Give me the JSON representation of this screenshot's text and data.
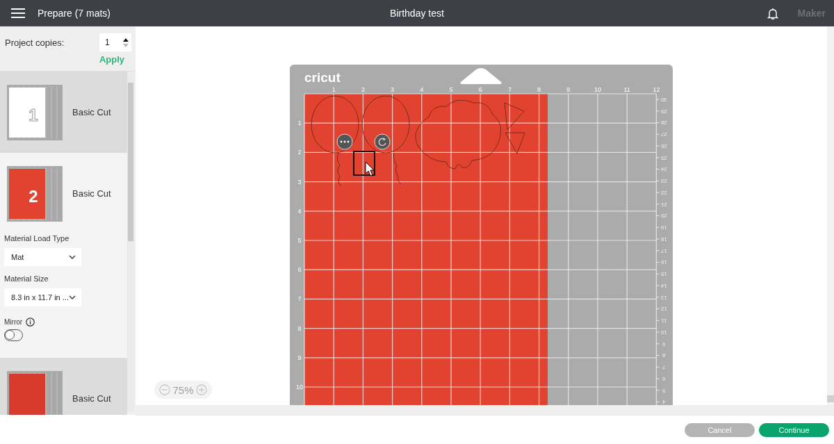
{
  "header": {
    "title": "Prepare (7 mats)",
    "project": "Birthday test",
    "machine": {
      "label": "Maker",
      "disabled": true
    }
  },
  "sidebar": {
    "copies_label": "Project copies:",
    "copies_value": "1",
    "apply": "Apply",
    "mats": [
      {
        "number": "1",
        "label": "Basic Cut",
        "color": "#ffffff",
        "selected": false
      },
      {
        "number": "2",
        "label": "Basic Cut",
        "color": "#e24330",
        "selected": true,
        "options": {
          "load_type_label": "Material Load Type",
          "load_type": "Mat",
          "size_label": "Material Size",
          "size": "8.3 in x 11.7 in ...",
          "mirror_label": "Mirror",
          "mirror_on": false
        }
      },
      {
        "label": "Basic Cut",
        "color": "#d63b2b",
        "selected": false
      }
    ]
  },
  "mat": {
    "logo": "cricut",
    "top_ruler": [
      "1",
      "2",
      "3",
      "4",
      "5",
      "6",
      "7",
      "8",
      "9",
      "10",
      "11",
      "12"
    ],
    "left_ruler": [
      "1",
      "2",
      "3",
      "4",
      "5",
      "6",
      "7",
      "8",
      "9",
      "10"
    ],
    "right_ruler": [
      "30",
      "29",
      "28",
      "27",
      "26",
      "25",
      "24",
      "23",
      "22",
      "21",
      "20",
      "19",
      "18",
      "17",
      "16",
      "15",
      "14",
      "13",
      "12",
      "11",
      "10",
      "9",
      "8",
      "7",
      "6",
      "5",
      "4"
    ]
  },
  "zoom": {
    "level": "75%"
  },
  "footer": {
    "buttons": [
      {
        "label": "Cancel",
        "kind": "secondary"
      },
      {
        "label": "Continue",
        "kind": "primary"
      }
    ]
  }
}
